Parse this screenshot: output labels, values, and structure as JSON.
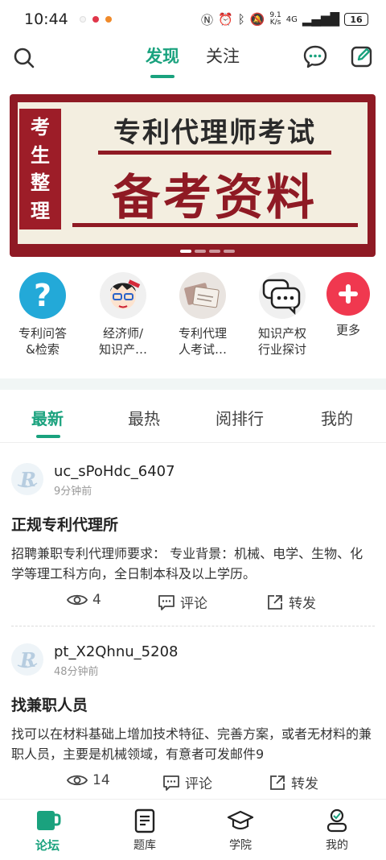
{
  "status_bar": {
    "time": "10:44",
    "net_speed_value": "9.1",
    "net_speed_unit": "K/s",
    "signal_label": "4G",
    "battery": "16"
  },
  "top_nav": {
    "tabs": [
      {
        "label": "发现",
        "active": true
      },
      {
        "label": "关注",
        "active": false
      }
    ]
  },
  "banner": {
    "side_chars": [
      "考",
      "生",
      "整",
      "理"
    ],
    "title": "专利代理师考试",
    "big_text": "备考资料"
  },
  "categories": [
    {
      "label": "专利问答\n&检索",
      "icon": "question-icon",
      "color": "#23a9d8"
    },
    {
      "label": "经济师/\n知识产…",
      "icon": "cartoon-avatar-icon",
      "color": "#f0f0f0"
    },
    {
      "label": "专利代理\n人考试…",
      "icon": "documents-icon",
      "color": "#e9e4e0"
    },
    {
      "label": "知识产权\n行业探讨",
      "icon": "chat-bubbles-icon",
      "color": "#f0f0f0"
    },
    {
      "label": "更多",
      "icon": "plus-icon",
      "color": "#f0384f"
    }
  ],
  "sub_tabs": [
    {
      "label": "最新",
      "active": true
    },
    {
      "label": "最热",
      "active": false
    },
    {
      "label": "阅排行",
      "active": false
    },
    {
      "label": "我的",
      "active": false
    }
  ],
  "posts": [
    {
      "username": "uc_sPoHdc_6407",
      "time": "9分钟前",
      "title": "正规专利代理所",
      "body": "招聘兼职专利代理师要求： 专业背景：机械、电学、生物、化学等理工科方向，全日制本科及以上学历。",
      "views": "4",
      "comment_label": "评论",
      "share_label": "转发"
    },
    {
      "username": "pt_X2Qhnu_5208",
      "time": "48分钟前",
      "title": "找兼职人员",
      "body": "找可以在材料基础上增加技术特征、完善方案，或者无材料的兼职人员，主要是机械领域，有意者可发邮件9",
      "views": "14",
      "comment_label": "评论",
      "share_label": "转发"
    }
  ],
  "bottom_nav": [
    {
      "label": "论坛",
      "icon": "cup-icon",
      "active": true
    },
    {
      "label": "题库",
      "icon": "document-list-icon",
      "active": false
    },
    {
      "label": "学院",
      "icon": "graduation-cap-icon",
      "active": false
    },
    {
      "label": "我的",
      "icon": "user-icon",
      "active": false
    }
  ],
  "colors": {
    "accent": "#1aa27e",
    "banner_red": "#8f1a24"
  }
}
